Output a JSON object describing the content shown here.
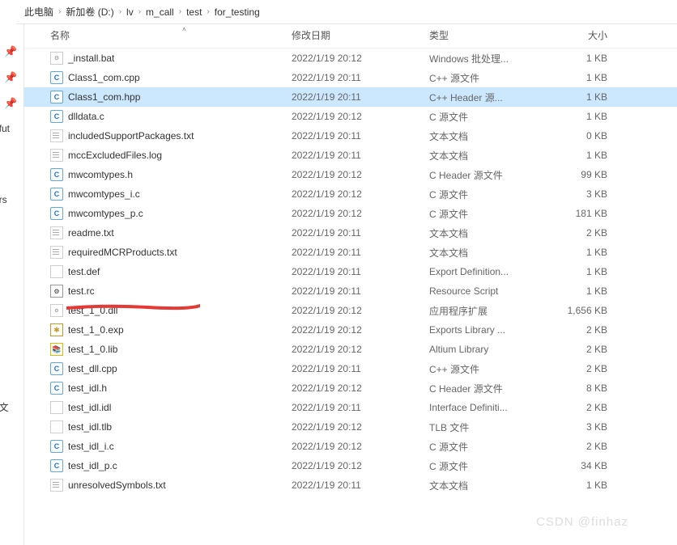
{
  "breadcrumb": [
    "此电脑",
    "新加卷 (D:)",
    "lv",
    "m_call",
    "test",
    "for_testing"
  ],
  "columns": {
    "name": "名称",
    "date": "修改日期",
    "type": "类型",
    "size": "大小"
  },
  "left_fragments": [
    "hfut",
    "ers",
    "e文"
  ],
  "files": [
    {
      "icon": "bat",
      "name": "_install.bat",
      "date": "2022/1/19 20:12",
      "type": "Windows 批处理...",
      "size": "1 KB",
      "selected": false
    },
    {
      "icon": "c",
      "name": "Class1_com.cpp",
      "date": "2022/1/19 20:11",
      "type": "C++ 源文件",
      "size": "1 KB",
      "selected": false
    },
    {
      "icon": "c",
      "name": "Class1_com.hpp",
      "date": "2022/1/19 20:11",
      "type": "C++ Header 源...",
      "size": "1 KB",
      "selected": true
    },
    {
      "icon": "c",
      "name": "dlldata.c",
      "date": "2022/1/19 20:12",
      "type": "C 源文件",
      "size": "1 KB",
      "selected": false
    },
    {
      "icon": "txt",
      "name": "includedSupportPackages.txt",
      "date": "2022/1/19 20:11",
      "type": "文本文档",
      "size": "0 KB",
      "selected": false
    },
    {
      "icon": "txt",
      "name": "mccExcludedFiles.log",
      "date": "2022/1/19 20:11",
      "type": "文本文档",
      "size": "1 KB",
      "selected": false
    },
    {
      "icon": "c",
      "name": "mwcomtypes.h",
      "date": "2022/1/19 20:12",
      "type": "C Header 源文件",
      "size": "99 KB",
      "selected": false
    },
    {
      "icon": "c",
      "name": "mwcomtypes_i.c",
      "date": "2022/1/19 20:12",
      "type": "C 源文件",
      "size": "3 KB",
      "selected": false
    },
    {
      "icon": "c",
      "name": "mwcomtypes_p.c",
      "date": "2022/1/19 20:12",
      "type": "C 源文件",
      "size": "181 KB",
      "selected": false
    },
    {
      "icon": "txt",
      "name": "readme.txt",
      "date": "2022/1/19 20:11",
      "type": "文本文档",
      "size": "2 KB",
      "selected": false
    },
    {
      "icon": "txt",
      "name": "requiredMCRProducts.txt",
      "date": "2022/1/19 20:11",
      "type": "文本文档",
      "size": "1 KB",
      "selected": false
    },
    {
      "icon": "def",
      "name": "test.def",
      "date": "2022/1/19 20:11",
      "type": "Export Definition...",
      "size": "1 KB",
      "selected": false
    },
    {
      "icon": "rc",
      "name": "test.rc",
      "date": "2022/1/19 20:11",
      "type": "Resource Script",
      "size": "1 KB",
      "selected": false
    },
    {
      "icon": "dll",
      "name": "test_1_0.dll",
      "date": "2022/1/19 20:12",
      "type": "应用程序扩展",
      "size": "1,656 KB",
      "selected": false
    },
    {
      "icon": "exp",
      "name": "test_1_0.exp",
      "date": "2022/1/19 20:12",
      "type": "Exports Library ...",
      "size": "2 KB",
      "selected": false
    },
    {
      "icon": "lib",
      "name": "test_1_0.lib",
      "date": "2022/1/19 20:12",
      "type": "Altium Library",
      "size": "2 KB",
      "selected": false
    },
    {
      "icon": "c",
      "name": "test_dll.cpp",
      "date": "2022/1/19 20:11",
      "type": "C++ 源文件",
      "size": "2 KB",
      "selected": false
    },
    {
      "icon": "c",
      "name": "test_idl.h",
      "date": "2022/1/19 20:12",
      "type": "C Header 源文件",
      "size": "8 KB",
      "selected": false
    },
    {
      "icon": "idl",
      "name": "test_idl.idl",
      "date": "2022/1/19 20:11",
      "type": "Interface Definiti...",
      "size": "2 KB",
      "selected": false
    },
    {
      "icon": "tlb",
      "name": "test_idl.tlb",
      "date": "2022/1/19 20:12",
      "type": "TLB 文件",
      "size": "3 KB",
      "selected": false
    },
    {
      "icon": "c",
      "name": "test_idl_i.c",
      "date": "2022/1/19 20:12",
      "type": "C 源文件",
      "size": "2 KB",
      "selected": false
    },
    {
      "icon": "c",
      "name": "test_idl_p.c",
      "date": "2022/1/19 20:12",
      "type": "C 源文件",
      "size": "34 KB",
      "selected": false
    },
    {
      "icon": "txt",
      "name": "unresolvedSymbols.txt",
      "date": "2022/1/19 20:11",
      "type": "文本文档",
      "size": "1 KB",
      "selected": false
    }
  ],
  "watermark": "CSDN @finhaz"
}
